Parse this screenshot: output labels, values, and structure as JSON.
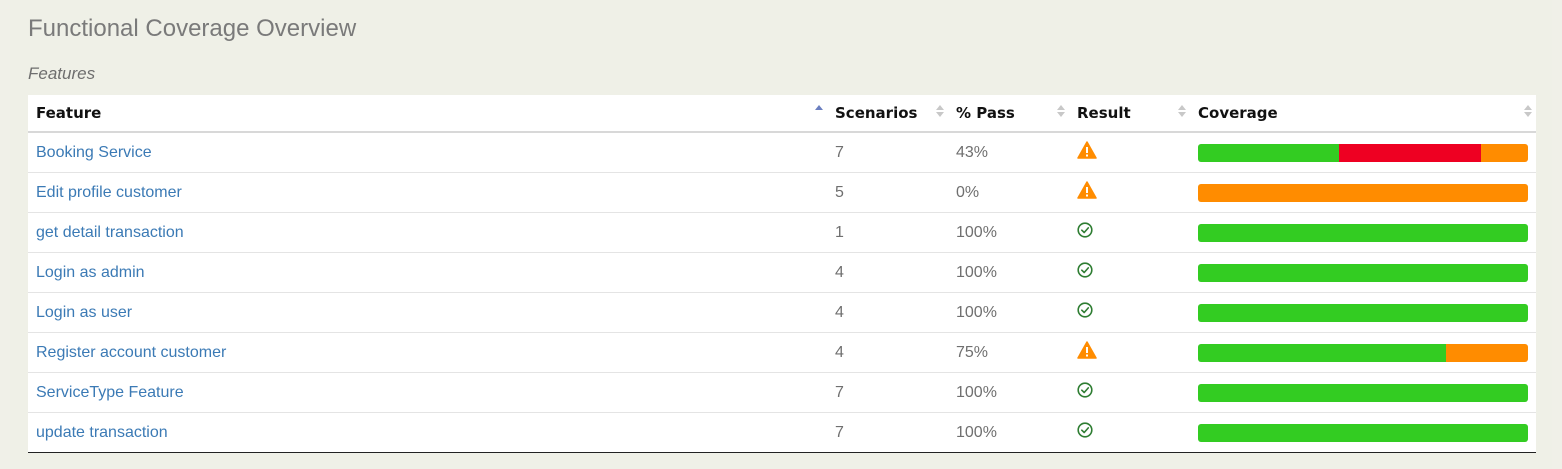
{
  "page": {
    "title": "Functional Coverage Overview",
    "section_title": "Features"
  },
  "columns": [
    {
      "label": "Feature",
      "sort": "asc"
    },
    {
      "label": "Scenarios",
      "sort": "none"
    },
    {
      "label": "% Pass",
      "sort": "none"
    },
    {
      "label": "Result",
      "sort": "none"
    },
    {
      "label": "Coverage",
      "sort": "none"
    }
  ],
  "colors": {
    "passed": "#33cc22",
    "failed": "#ee0022",
    "pending": "#ff8c00",
    "link": "#3b7ab5"
  },
  "rows": [
    {
      "feature": "Booking Service",
      "scenarios": "7",
      "pass": "43%",
      "result": "warning-icon",
      "coverage": {
        "passed": 3,
        "failed": 3,
        "pending": 1
      }
    },
    {
      "feature": "Edit profile customer",
      "scenarios": "5",
      "pass": "0%",
      "result": "warning-icon",
      "coverage": {
        "passed": 0,
        "failed": 0,
        "pending": 5
      }
    },
    {
      "feature": "get detail transaction",
      "scenarios": "1",
      "pass": "100%",
      "result": "check-circle-icon",
      "coverage": {
        "passed": 1,
        "failed": 0,
        "pending": 0
      }
    },
    {
      "feature": "Login as admin",
      "scenarios": "4",
      "pass": "100%",
      "result": "check-circle-icon",
      "coverage": {
        "passed": 4,
        "failed": 0,
        "pending": 0
      }
    },
    {
      "feature": "Login as user",
      "scenarios": "4",
      "pass": "100%",
      "result": "check-circle-icon",
      "coverage": {
        "passed": 4,
        "failed": 0,
        "pending": 0
      }
    },
    {
      "feature": "Register account customer",
      "scenarios": "4",
      "pass": "75%",
      "result": "warning-icon",
      "coverage": {
        "passed": 3,
        "failed": 0,
        "pending": 1
      }
    },
    {
      "feature": "ServiceType Feature",
      "scenarios": "7",
      "pass": "100%",
      "result": "check-circle-icon",
      "coverage": {
        "passed": 7,
        "failed": 0,
        "pending": 0
      }
    },
    {
      "feature": "update transaction",
      "scenarios": "7",
      "pass": "100%",
      "result": "check-circle-icon",
      "coverage": {
        "passed": 7,
        "failed": 0,
        "pending": 0
      }
    }
  ]
}
